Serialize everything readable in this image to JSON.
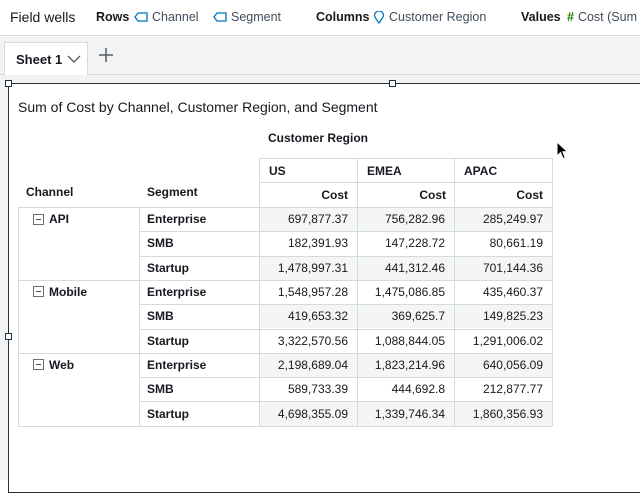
{
  "field_wells": {
    "title": "Field wells",
    "rows_label": "Rows",
    "rows": [
      "Channel",
      "Segment"
    ],
    "columns_label": "Columns",
    "columns": [
      "Customer Region"
    ],
    "values_label": "Values",
    "values": [
      "Cost (Sum"
    ]
  },
  "tabs": [
    {
      "label": "Sheet 1"
    }
  ],
  "visual": {
    "title": "Sum of Cost by Channel, Customer Region, and Segment",
    "column_field": "Customer Region",
    "row_headers": [
      "Channel",
      "Segment"
    ],
    "regions": [
      "US",
      "EMEA",
      "APAC"
    ],
    "measure": "Cost",
    "groups": [
      {
        "channel": "API",
        "rows": [
          {
            "segment": "Enterprise",
            "values": [
              "697,877.37",
              "756,282.96",
              "285,249.97"
            ]
          },
          {
            "segment": "SMB",
            "values": [
              "182,391.93",
              "147,228.72",
              "80,661.19"
            ]
          },
          {
            "segment": "Startup",
            "values": [
              "1,478,997.31",
              "441,312.46",
              "701,144.36"
            ]
          }
        ]
      },
      {
        "channel": "Mobile",
        "rows": [
          {
            "segment": "Enterprise",
            "values": [
              "1,548,957.28",
              "1,475,086.85",
              "435,460.37"
            ]
          },
          {
            "segment": "SMB",
            "values": [
              "419,653.32",
              "369,625.7",
              "149,825.23"
            ]
          },
          {
            "segment": "Startup",
            "values": [
              "3,322,570.56",
              "1,088,844.05",
              "1,291,006.02"
            ]
          }
        ]
      },
      {
        "channel": "Web",
        "rows": [
          {
            "segment": "Enterprise",
            "values": [
              "2,198,689.04",
              "1,823,214.96",
              "640,056.09"
            ]
          },
          {
            "segment": "SMB",
            "values": [
              "589,733.39",
              "444,692.8",
              "212,877.77"
            ]
          },
          {
            "segment": "Startup",
            "values": [
              "4,698,355.09",
              "1,339,746.34",
              "1,860,356.93"
            ]
          }
        ]
      }
    ]
  }
}
